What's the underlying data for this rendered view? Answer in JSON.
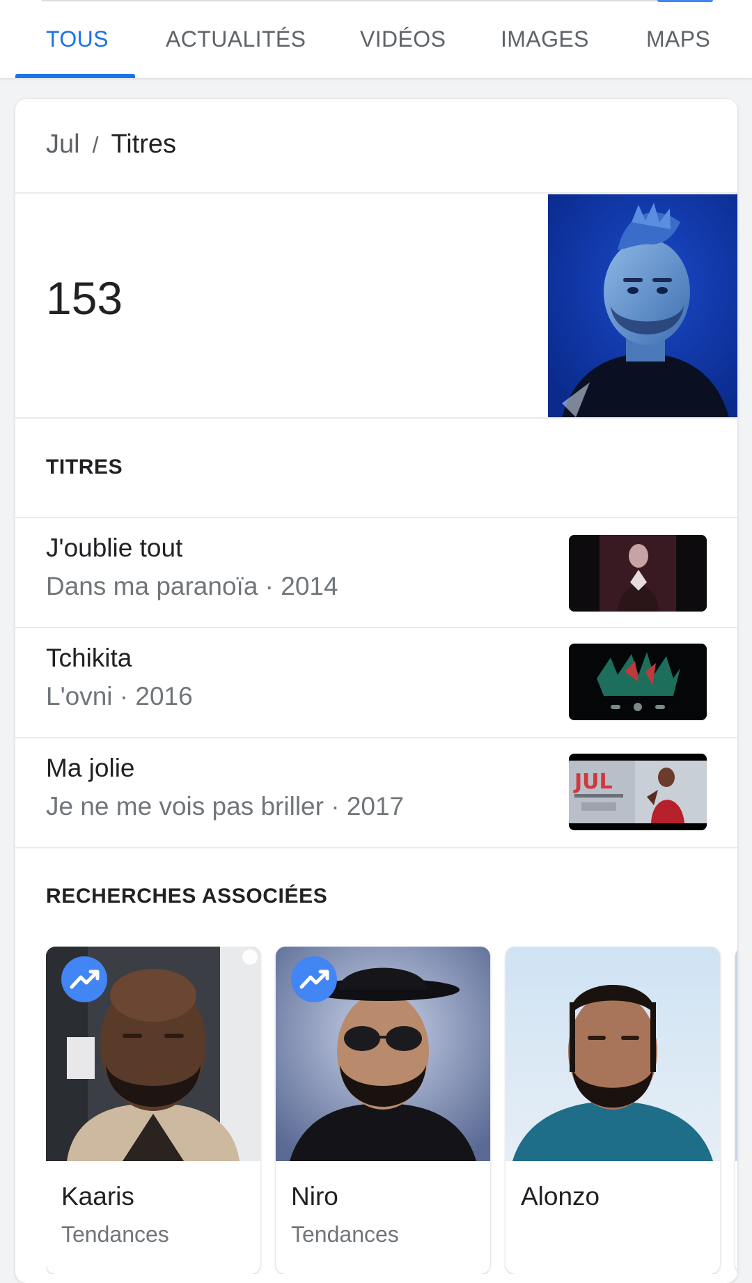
{
  "tabs": [
    {
      "label": "TOUS",
      "active": true
    },
    {
      "label": "ACTUALITÉS",
      "active": false
    },
    {
      "label": "VIDÉOS",
      "active": false
    },
    {
      "label": "IMAGES",
      "active": false
    },
    {
      "label": "MAPS",
      "active": false
    }
  ],
  "colors": {
    "accent": "#1a73e8",
    "trend_badge": "#4285f4"
  },
  "breadcrumb": {
    "parent": "Jul",
    "separator": "/",
    "current": "Titres"
  },
  "summary": {
    "count": "153"
  },
  "songs_section": {
    "title": "TITRES",
    "items": [
      {
        "title": "J'oublie tout",
        "subtitle": "Dans ma paranoïa · 2014",
        "thumb_icon": "video-thumbnail-icon"
      },
      {
        "title": "Tchikita",
        "subtitle": "L'ovni · 2016",
        "thumb_icon": "video-thumbnail-icon"
      },
      {
        "title": "Ma jolie",
        "subtitle": "Je ne me vois pas briller · 2017",
        "thumb_icon": "video-thumbnail-icon"
      }
    ]
  },
  "related_section": {
    "title": "RECHERCHES ASSOCIÉES",
    "items": [
      {
        "name": "Kaaris",
        "tag": "Tendances",
        "trending": true
      },
      {
        "name": "Niro",
        "tag": "Tendances",
        "trending": true
      },
      {
        "name": "Alonzo",
        "tag": "",
        "trending": false
      }
    ]
  }
}
